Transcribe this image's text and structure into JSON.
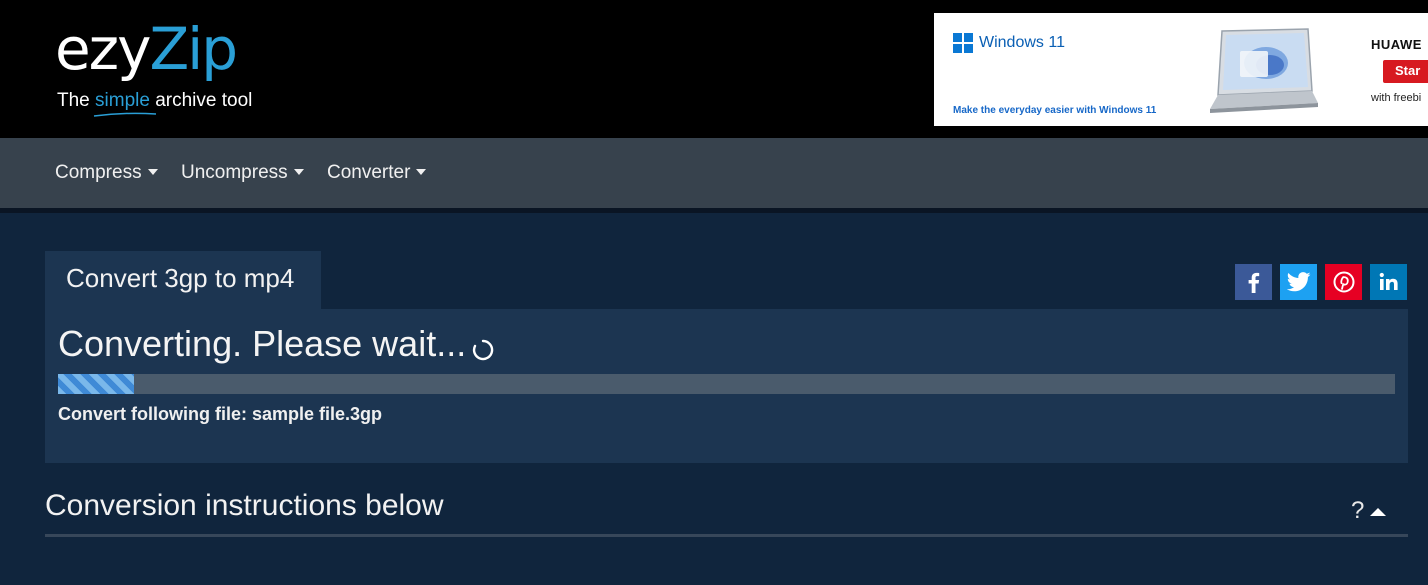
{
  "header": {
    "logo": {
      "part1": "ezy",
      "part2": "Zip"
    },
    "tagline": {
      "before": "The ",
      "highlight": "simple",
      "after": " archive tool"
    }
  },
  "ad": {
    "product": "Windows 11",
    "tagline": "Make the everyday easier with Windows 11",
    "brand": "HUAWE",
    "button": "Star",
    "extra": "with freebi"
  },
  "nav": {
    "items": [
      {
        "label": "Compress"
      },
      {
        "label": "Uncompress"
      },
      {
        "label": "Converter"
      }
    ]
  },
  "main": {
    "tab_title": "Convert 3gp to mp4",
    "status": "Converting. Please wait...",
    "progress": 0.057,
    "file_line": "Convert following file: sample file.3gp",
    "instructions_heading": "Conversion instructions below",
    "help_label": "?"
  },
  "social": [
    {
      "name": "facebook",
      "glyph": "f"
    },
    {
      "name": "twitter",
      "glyph": ""
    },
    {
      "name": "pinterest",
      "glyph": ""
    },
    {
      "name": "linkedin",
      "glyph": "in"
    }
  ],
  "colors": {
    "accent": "#2a9fd6",
    "background": "#10253d",
    "panel": "#1c3551",
    "navbar": "#37424d",
    "progress_fill": "#3f8ad6"
  }
}
